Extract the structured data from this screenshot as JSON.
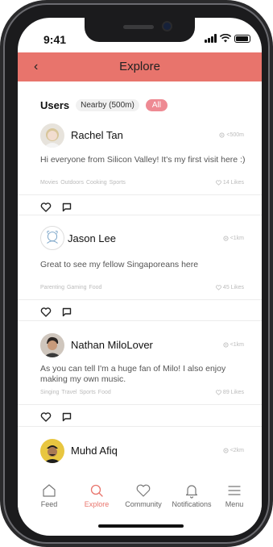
{
  "status_bar": {
    "time": "9:41"
  },
  "header": {
    "back_icon": "‹",
    "title": "Explore"
  },
  "filters": {
    "label": "Users",
    "nearby": "Nearby (500m)",
    "all": "All"
  },
  "posts": [
    {
      "name": "Rachel Tan",
      "distance": "<500m",
      "text": "Hi everyone from Silicon Valley! It's my first visit here :)",
      "tags": [
        "Movies",
        "Outdoors",
        "Cooking",
        "Sports"
      ],
      "likes": "14 Likes"
    },
    {
      "name": "Jason Lee",
      "distance": "<1km",
      "text": "Great to see my fellow Singaporeans here",
      "tags": [
        "Parenting",
        "Gaming",
        "Food"
      ],
      "likes": "45 Likes"
    },
    {
      "name": "Nathan MiloLover",
      "distance": "<1km",
      "text": "As you can tell I'm a huge fan of Milo! I also enjoy making my own music.",
      "tags": [
        "Singing",
        "Travel",
        "Sports",
        "Food"
      ],
      "likes": "89 Likes"
    },
    {
      "name": "Muhd Afiq",
      "distance": "<2km"
    }
  ],
  "tabs": [
    {
      "label": "Feed",
      "icon": "home-icon"
    },
    {
      "label": "Explore",
      "icon": "search-icon",
      "active": true
    },
    {
      "label": "Community",
      "icon": "heart-icon"
    },
    {
      "label": "Notifications",
      "icon": "bell-icon"
    },
    {
      "label": "Menu",
      "icon": "menu-icon"
    }
  ],
  "colors": {
    "accent": "#e8746c",
    "chip_active": "#ee8a93"
  }
}
